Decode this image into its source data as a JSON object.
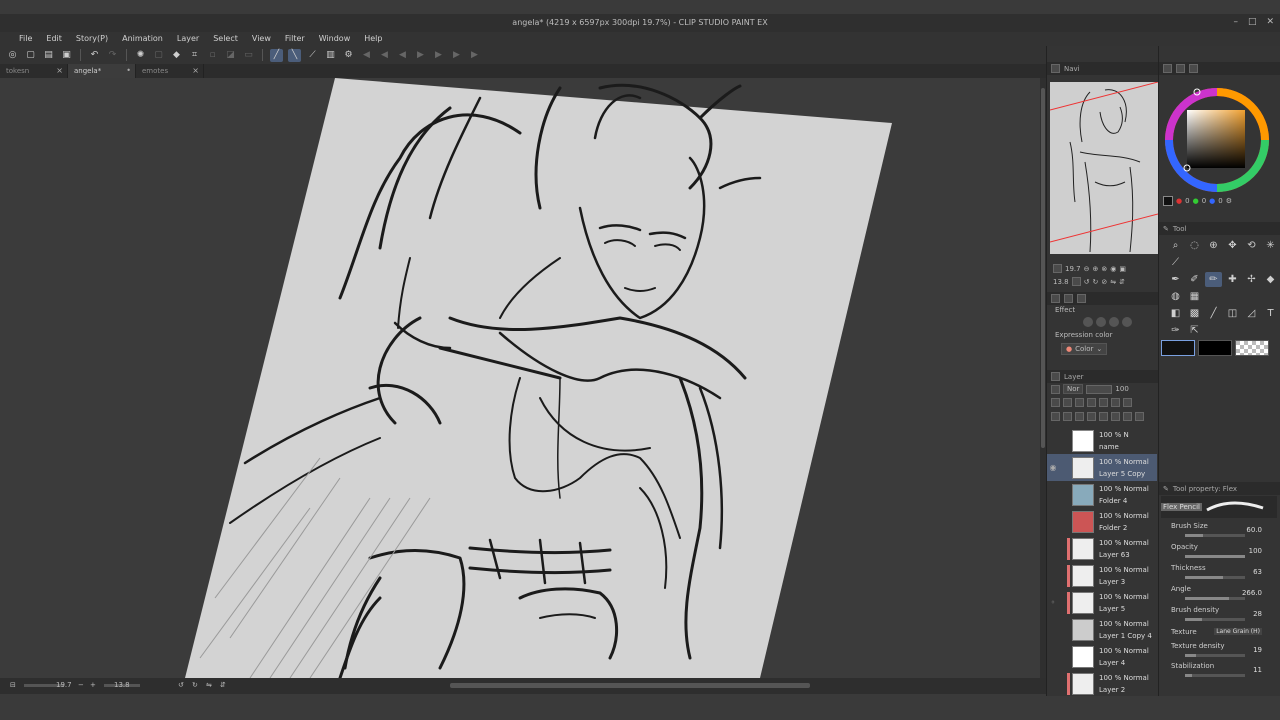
{
  "window": {
    "title": "angela* (4219 x 6597px 300dpi 19.7%) - CLIP STUDIO PAINT EX",
    "controls": [
      "–",
      "□",
      "✕"
    ]
  },
  "menu": [
    "File",
    "Edit",
    "Story(P)",
    "Animation",
    "Layer",
    "Select",
    "View",
    "Filter",
    "Window",
    "Help"
  ],
  "tabs": [
    {
      "label": "tokesn",
      "active": false
    },
    {
      "label": "angela*",
      "active": true
    },
    {
      "label": "emotes",
      "active": false
    }
  ],
  "status": {
    "zoom": "19.7",
    "angle": "13.8"
  },
  "navigator": {
    "tab_label": "Navi",
    "zoom": "19.7",
    "angle": "13.8"
  },
  "sub_tool": {
    "effect_label": "Effect",
    "expression_label": "Expression color",
    "expression_value": "Color"
  },
  "layer_panel": {
    "tab_label": "Layer",
    "blend_mode": "Nor",
    "opacity": "100",
    "layers": [
      {
        "mode": "100 % N",
        "name": "name",
        "color": "",
        "selected": false,
        "visible": false
      },
      {
        "mode": "100 % Normal",
        "name": "Layer 5 Copy",
        "color": "",
        "selected": true,
        "visible": true
      },
      {
        "mode": "100 % Normal",
        "name": "Folder 4",
        "color": "",
        "selected": false,
        "visible": false
      },
      {
        "mode": "100 % Normal",
        "name": "Folder 2",
        "color": "",
        "selected": false,
        "visible": false
      },
      {
        "mode": "100 % Normal",
        "name": "Layer 63",
        "color": "#e07070",
        "selected": false,
        "visible": false
      },
      {
        "mode": "100 % Normal",
        "name": "Layer 3",
        "color": "#e07070",
        "selected": false,
        "visible": false
      },
      {
        "mode": "100 % Normal",
        "name": "Layer 5",
        "color": "#e07070",
        "selected": false,
        "visible": true
      },
      {
        "mode": "100 % Normal",
        "name": "Layer 1 Copy 4",
        "color": "",
        "selected": false,
        "visible": false
      },
      {
        "mode": "100 % Normal",
        "name": "Layer 4",
        "color": "",
        "selected": false,
        "visible": false
      },
      {
        "mode": "100 % Normal",
        "name": "Layer 2",
        "color": "#e07070",
        "selected": false,
        "visible": false
      }
    ]
  },
  "color": {
    "r": "0",
    "g": "0",
    "b": "0",
    "main": "#1a1a1a",
    "sub": "#ffffff"
  },
  "tool_panel": {
    "tab_label": "Tool"
  },
  "tool_property": {
    "tab_label": "Tool property: Flex",
    "brush_name": "Flex Pencil",
    "brush_size": {
      "label": "Brush Size",
      "value": "60.0"
    },
    "opacity": {
      "label": "Opacity",
      "value": "100"
    },
    "thickness": {
      "label": "Thickness",
      "value": "63"
    },
    "angle": {
      "label": "Angle",
      "value": "266.0"
    },
    "brush_density": {
      "label": "Brush density",
      "value": "28"
    },
    "texture": {
      "label": "Texture",
      "value": "Lane Grain (H)"
    },
    "texture_density": {
      "label": "Texture density",
      "value": "19"
    },
    "stabilization": {
      "label": "Stabilization",
      "value": "11"
    }
  }
}
